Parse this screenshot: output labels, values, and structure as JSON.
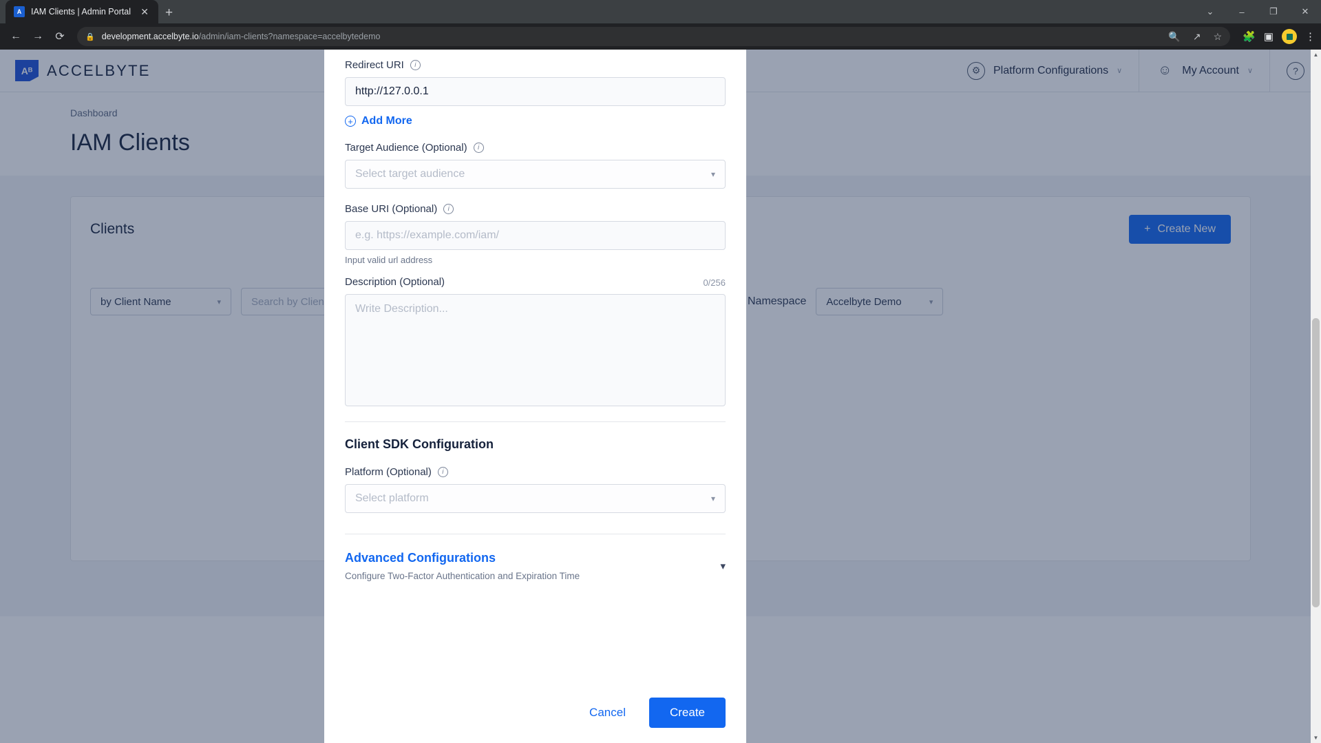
{
  "browser": {
    "tab": {
      "title": "IAM Clients | Admin Portal",
      "favicon_label": "A",
      "close_icon": "close-icon"
    },
    "newtab_label": "+",
    "window_controls": {
      "minimize": "–",
      "maximize": "❐",
      "close": "✕",
      "tab_search": "⌄"
    },
    "nav": {
      "back": "←",
      "forward": "→",
      "reload": "⟳"
    },
    "address": {
      "lock_icon": "lock-icon",
      "domain": "development.accelbyte.io",
      "path": "/admin/iam-clients?namespace=accelbytedemo"
    },
    "omnibox_icons": [
      "zoom-icon",
      "share-icon",
      "bookmark-star-icon"
    ],
    "toolbar_icons": [
      "extensions-puzzle-icon",
      "side-panel-icon",
      "profile-avatar-icon",
      "chrome-menu-icon"
    ]
  },
  "app": {
    "logo": {
      "mark": "Aᴮ",
      "text": "ACCELBYTE"
    },
    "header_items": [
      {
        "label": "Platform Configurations",
        "icon": "gear-icon",
        "chevron": "∨"
      },
      {
        "label": "My Account",
        "icon": "person-icon",
        "chevron": "∨"
      }
    ],
    "help_icon": "?",
    "breadcrumb": "Dashboard",
    "page_title": "IAM Clients",
    "card": {
      "title": "Clients",
      "create_new_label": "Create New",
      "create_new_icon": "+",
      "filter_by": "by Client Name",
      "search_placeholder": "Search by Client Name",
      "namespace_label": "Namespace",
      "namespace_value": "Accelbyte Demo"
    }
  },
  "modal": {
    "redirect_uri": {
      "label": "Redirect URI",
      "info_icon": "info-icon",
      "value": "http://127.0.0.1",
      "add_more_label": "Add More",
      "add_more_icon": "plus-circle-icon"
    },
    "target_audience": {
      "label": "Target Audience (Optional)",
      "info_icon": "info-icon",
      "placeholder": "Select target audience",
      "chevron_icon": "chevron-down-icon"
    },
    "base_uri": {
      "label": "Base URI (Optional)",
      "info_icon": "info-icon",
      "placeholder": "e.g. https://example.com/iam/",
      "helper": "Input valid url address"
    },
    "description": {
      "label": "Description (Optional)",
      "counter": "0/256",
      "placeholder": "Write Description..."
    },
    "sdk_section_title": "Client SDK Configuration",
    "platform": {
      "label": "Platform (Optional)",
      "info_icon": "info-icon",
      "placeholder": "Select platform",
      "chevron_icon": "chevron-down-icon"
    },
    "advanced": {
      "title": "Advanced Configurations",
      "subtitle": "Configure Two-Factor Authentication and Expiration Time",
      "chevron_icon": "chevron-down-icon"
    },
    "footer": {
      "cancel_label": "Cancel",
      "create_label": "Create"
    }
  },
  "colors": {
    "accent": "#1267f0",
    "overlay": "rgba(32,48,85,0.45)",
    "text_dark": "#15213b"
  }
}
